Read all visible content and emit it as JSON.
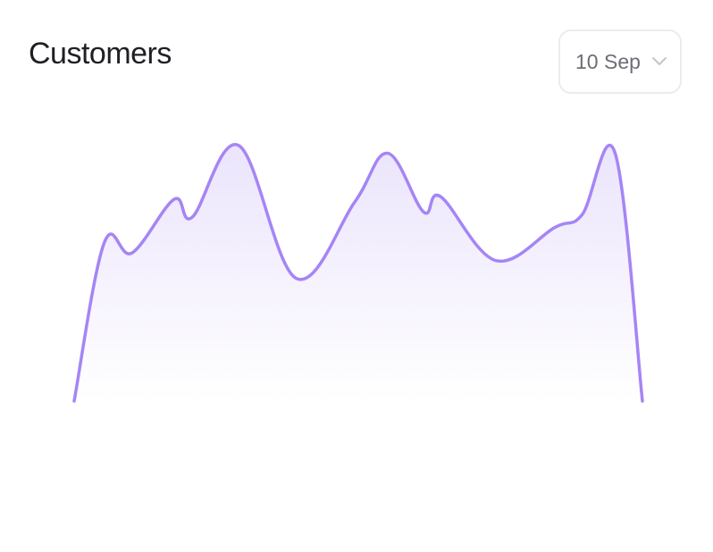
{
  "card": {
    "title": "Customers",
    "date_select": {
      "value": "10 Sep",
      "icon": "chevron-down-icon"
    }
  },
  "colors": {
    "line": "#a585f5",
    "fill_top": "#ebe4fc",
    "fill_bottom": "#ffffff",
    "title": "#1f1f24",
    "select_border": "#ececf0",
    "select_text": "#6d6d75"
  },
  "chart_data": {
    "type": "area",
    "title": "Customers",
    "xlabel": "",
    "ylabel": "",
    "axes_visible": false,
    "grid": false,
    "ylim": [
      0,
      100
    ],
    "x": [
      0,
      1,
      2,
      3,
      4,
      5,
      6,
      7,
      8,
      9,
      10,
      11,
      12,
      13,
      14,
      15,
      16,
      17,
      18,
      19,
      20
    ],
    "values": [
      0,
      62,
      58,
      79,
      72,
      100,
      48,
      78,
      97,
      74,
      80,
      55,
      68,
      73,
      97,
      0
    ],
    "series": [
      {
        "values": [
          0,
          62,
          58,
          79,
          72,
          100,
          48,
          78,
          97,
          74,
          80,
          55,
          68,
          73,
          97,
          0
        ]
      }
    ]
  }
}
